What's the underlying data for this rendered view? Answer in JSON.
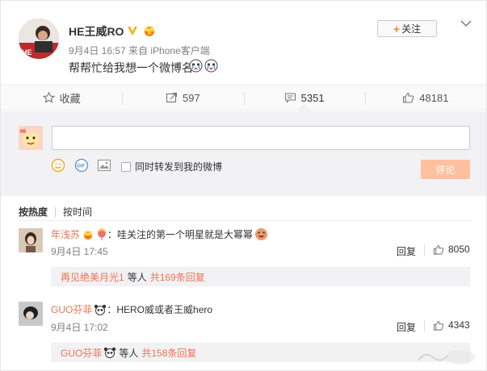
{
  "post": {
    "username": "HE王威RO",
    "timestamp": "9月4日 16:57 来自 iPhone客户端",
    "text": "帮帮忙给我想一个微博名",
    "follow_label": "关注",
    "follow_plus": "+"
  },
  "actions": {
    "favorite": "收藏",
    "repost_count": "597",
    "comment_count": "5351",
    "like_count": "48181"
  },
  "composer": {
    "input_value": "",
    "repost_checkbox_label": "同时转发到我的微博",
    "submit_label": "评论"
  },
  "sort": {
    "by_hot": "按热度",
    "by_time": "按时间"
  },
  "comments": [
    {
      "name": "年浅苏",
      "text": "：哇关注的第一个明星就是大幂幂",
      "time": "9月4日 17:45",
      "reply_label": "回复",
      "likes": "8050",
      "sub": {
        "user": "再见绝美月光1",
        "mid": "等人",
        "count": "共169条回复"
      }
    },
    {
      "name": "GUO芬菲",
      "text": "：HERO威或者王威hero",
      "time": "9月4日 17:02",
      "reply_label": "回复",
      "likes": "4343",
      "sub": {
        "user": "GUO芬菲",
        "mid": "等人",
        "count": "共158条回复"
      }
    }
  ],
  "colors": {
    "accent_orange": "#eb7350",
    "submit_disabled": "#ffc09f",
    "verified_gold": "#f7b000"
  },
  "icons": [
    "verified-v-icon",
    "vip-crown-icon",
    "chevron-down-icon",
    "star-icon",
    "repost-icon",
    "comment-icon",
    "thumb-up-icon",
    "smiley-icon",
    "gif-icon",
    "image-icon"
  ]
}
